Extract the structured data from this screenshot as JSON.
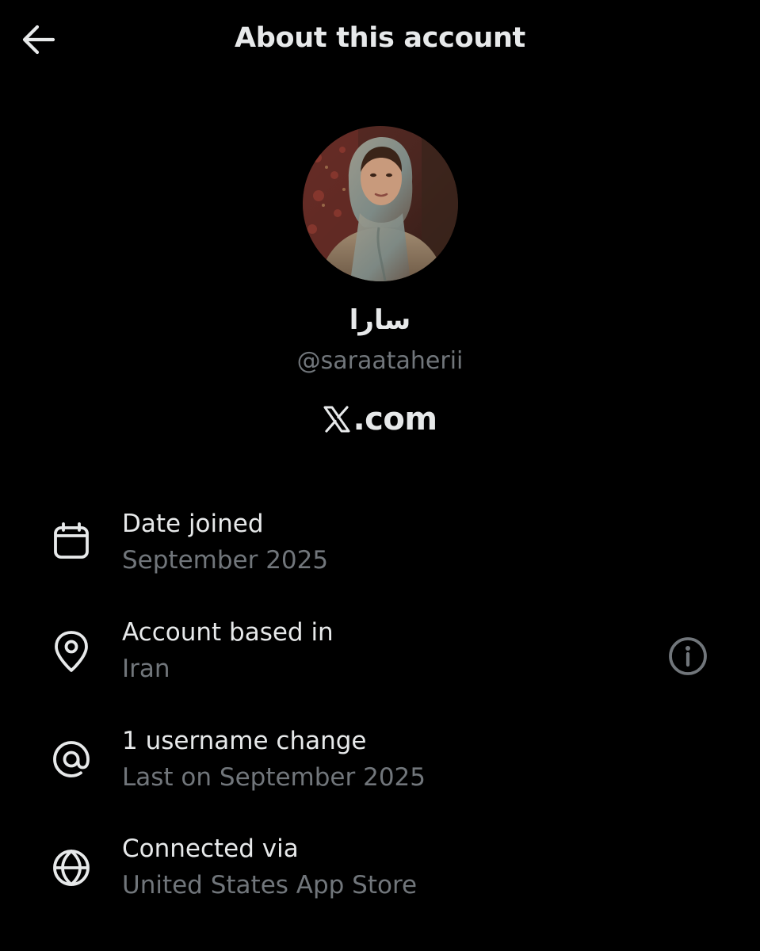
{
  "header": {
    "back_icon": "arrow-left-icon",
    "title": "About this account"
  },
  "profile": {
    "display_name": "سارا",
    "handle": "@saraataherii",
    "platform_logo_icon": "x-logo-icon",
    "platform_text": ".com"
  },
  "info": [
    {
      "icon": "calendar-icon",
      "label": "Date joined",
      "value": "September 2025"
    },
    {
      "icon": "location-pin-icon",
      "label": "Account based in",
      "value": "Iran",
      "action_icon": "info-icon"
    },
    {
      "icon": "at-sign-icon",
      "label": "1 username change",
      "value": "Last on September 2025"
    },
    {
      "icon": "globe-icon",
      "label": "Connected via",
      "value": "United States App Store"
    }
  ],
  "colors": {
    "background": "#000000",
    "primary_text": "#e7e9ea",
    "secondary_text": "#71767b"
  }
}
